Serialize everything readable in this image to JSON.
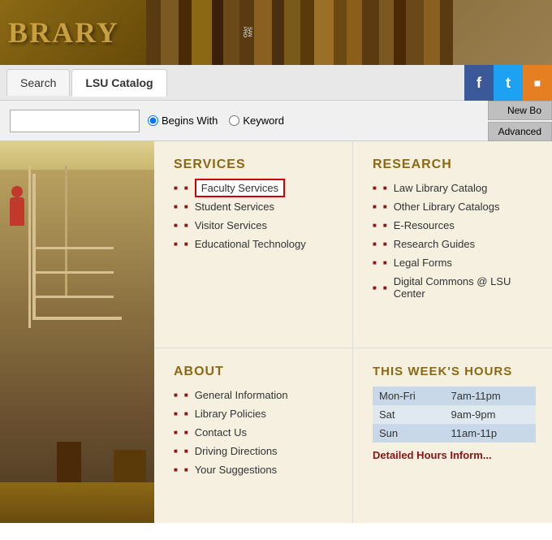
{
  "header": {
    "title": "BRARY",
    "full_title": "LSU LIBRARY"
  },
  "navbar": {
    "tabs": [
      {
        "label": "Search",
        "active": false
      },
      {
        "label": "LSU Catalog",
        "active": true
      }
    ],
    "social": {
      "facebook": "f",
      "twitter": "t",
      "rss": "r"
    }
  },
  "searchbar": {
    "placeholder": "",
    "radio_options": [
      {
        "label": "Begins With",
        "selected": true
      },
      {
        "label": "Keyword",
        "selected": false
      }
    ],
    "new_bo_label": "New Bo",
    "advanced_label": "Advanced"
  },
  "sections": {
    "services": {
      "title": "SERVICES",
      "items": [
        {
          "label": "Faculty Services",
          "highlighted": true
        },
        {
          "label": "Student Services",
          "highlighted": false
        },
        {
          "label": "Visitor Services",
          "highlighted": false
        },
        {
          "label": "Educational Technology",
          "highlighted": false
        }
      ]
    },
    "research": {
      "title": "RESEARCH",
      "items": [
        {
          "label": "Law Library Catalog"
        },
        {
          "label": "Other Library Catalogs"
        },
        {
          "label": "E-Resources"
        },
        {
          "label": "Research Guides"
        },
        {
          "label": "Legal Forms"
        },
        {
          "label": "Digital Commons @ LSU Center"
        }
      ]
    },
    "about": {
      "title": "ABOUT",
      "items": [
        {
          "label": "General Information"
        },
        {
          "label": "Library Policies"
        },
        {
          "label": "Contact Us"
        },
        {
          "label": "Driving Directions"
        },
        {
          "label": "Your Suggestions"
        }
      ]
    },
    "hours": {
      "title": "THIS WEEK'S HOURS",
      "rows": [
        {
          "day": "Mon-Fri",
          "hours": "7am-11pm"
        },
        {
          "day": "Sat",
          "hours": "9am-9pm"
        },
        {
          "day": "Sun",
          "hours": "11am-11p"
        }
      ],
      "link_label": "Detailed Hours Inform..."
    }
  }
}
